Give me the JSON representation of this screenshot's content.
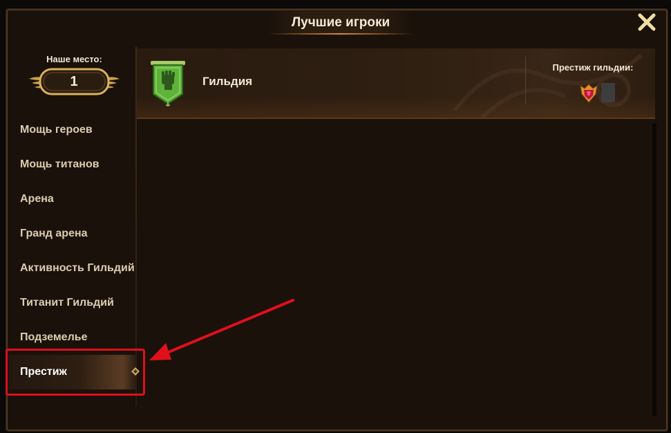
{
  "window": {
    "title": "Лучшие игроки"
  },
  "our_place": {
    "label": "Наше место:",
    "value": "1"
  },
  "sidebar": {
    "items": [
      {
        "label": "Мощь героев",
        "active": false
      },
      {
        "label": "Мощь титанов",
        "active": false
      },
      {
        "label": "Арена",
        "active": false
      },
      {
        "label": "Гранд арена",
        "active": false
      },
      {
        "label": "Активность Гильдий",
        "active": false
      },
      {
        "label": "Титанит Гильдий",
        "active": false
      },
      {
        "label": "Подземелье",
        "active": false
      },
      {
        "label": "Престиж",
        "active": true
      }
    ]
  },
  "ranking": {
    "rows": [
      {
        "guild_name": "Гильдия",
        "banner_icon": "fist-banner-icon",
        "banner_color": "#5fb23a",
        "prestige_label": "Престиж гильдии:",
        "prestige_icon": "prestige-crest-icon"
      }
    ]
  },
  "colors": {
    "background": "#1a110a",
    "accent_gold": "#d68b30",
    "highlight_red": "#e0101a"
  },
  "icons": {
    "close": "close-icon",
    "laurel": "laurel-wings-icon",
    "active_marker": "diamond-icon",
    "annotation_arrow": "red-arrow-icon"
  }
}
